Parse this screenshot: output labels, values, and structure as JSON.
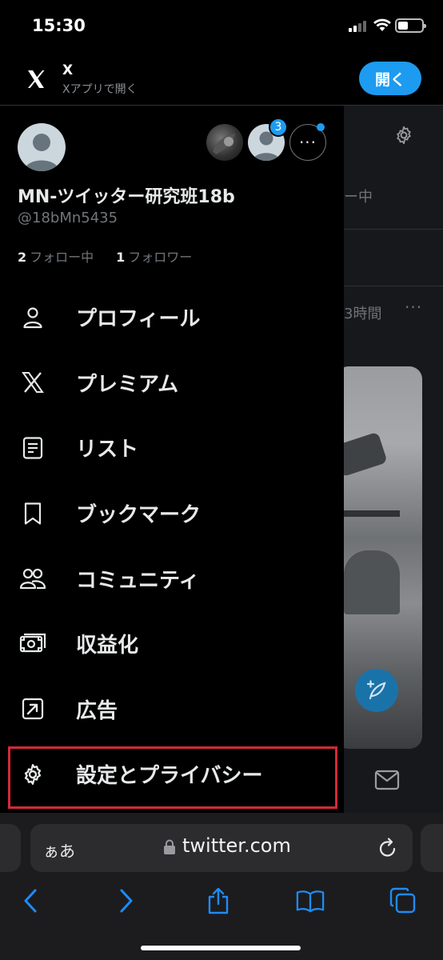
{
  "status_bar": {
    "time": "15:30"
  },
  "app_banner": {
    "name": "X",
    "subtitle": "Xアプリで開く",
    "open_label": "開く"
  },
  "background": {
    "fragment_following": "ー中",
    "fragment_time": "3時間",
    "more_dots": "···"
  },
  "profile": {
    "display_name": "MN-ツイッター研究班18b",
    "handle": "@18bMn5435",
    "following_count": "2",
    "following_label": "フォロー中",
    "followers_count": "1",
    "followers_label": "フォロワー",
    "account_badge": "3",
    "more_label": "···"
  },
  "menu": [
    {
      "label": "プロフィール",
      "icon": "person-icon"
    },
    {
      "label": "プレミアム",
      "icon": "x-logo-icon"
    },
    {
      "label": "リスト",
      "icon": "list-icon"
    },
    {
      "label": "ブックマーク",
      "icon": "bookmark-icon"
    },
    {
      "label": "コミュニティ",
      "icon": "community-icon"
    },
    {
      "label": "収益化",
      "icon": "money-icon"
    },
    {
      "label": "広告",
      "icon": "ads-icon"
    },
    {
      "label": "設定とプライバシー",
      "icon": "gear-icon",
      "highlighted": true
    }
  ],
  "safari": {
    "text_size": "ぁあ",
    "url": "twitter.com"
  },
  "colors": {
    "accent": "#1d9bf0",
    "highlight_box": "#d32a36",
    "background": "#000000"
  }
}
